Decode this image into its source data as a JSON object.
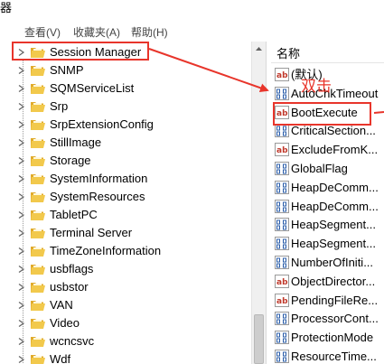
{
  "window": {
    "title_fragment": "器"
  },
  "menubar": {
    "items": [
      "查看(V)",
      "收藏夹(A)",
      "帮助(H)"
    ]
  },
  "tree": {
    "items": [
      "Session Manager",
      "SNMP",
      "SQMServiceList",
      "Srp",
      "SrpExtensionConfig",
      "StillImage",
      "Storage",
      "SystemInformation",
      "SystemResources",
      "TabletPC",
      "Terminal Server",
      "TimeZoneInformation",
      "usbflags",
      "usbstor",
      "VAN",
      "Video",
      "wcncsvc",
      "Wdf"
    ],
    "selected": "Session Manager"
  },
  "values_pane": {
    "column_header": "名称",
    "items": [
      {
        "label": "(默认)",
        "type": "string"
      },
      {
        "label": "AutoChkTimeout",
        "type": "binary"
      },
      {
        "label": "BootExecute",
        "type": "string"
      },
      {
        "label": "CriticalSection...",
        "type": "binary"
      },
      {
        "label": "ExcludeFromK...",
        "type": "string"
      },
      {
        "label": "GlobalFlag",
        "type": "binary"
      },
      {
        "label": "HeapDeComm...",
        "type": "binary"
      },
      {
        "label": "HeapDeComm...",
        "type": "binary"
      },
      {
        "label": "HeapSegment...",
        "type": "binary"
      },
      {
        "label": "HeapSegment...",
        "type": "binary"
      },
      {
        "label": "NumberOfIniti...",
        "type": "binary"
      },
      {
        "label": "ObjectDirector...",
        "type": "string"
      },
      {
        "label": "PendingFileRe...",
        "type": "string"
      },
      {
        "label": "ProcessorCont...",
        "type": "binary"
      },
      {
        "label": "ProtectionMode",
        "type": "binary"
      },
      {
        "label": "ResourceTime...",
        "type": "binary"
      }
    ]
  },
  "annotation": {
    "text": "双击"
  },
  "colors": {
    "annotation_red": "#e8352b",
    "folder_yellow": "#f2c94c",
    "string_icon_red": "#c0392b",
    "binary_icon_blue": "#2a5ca8"
  }
}
